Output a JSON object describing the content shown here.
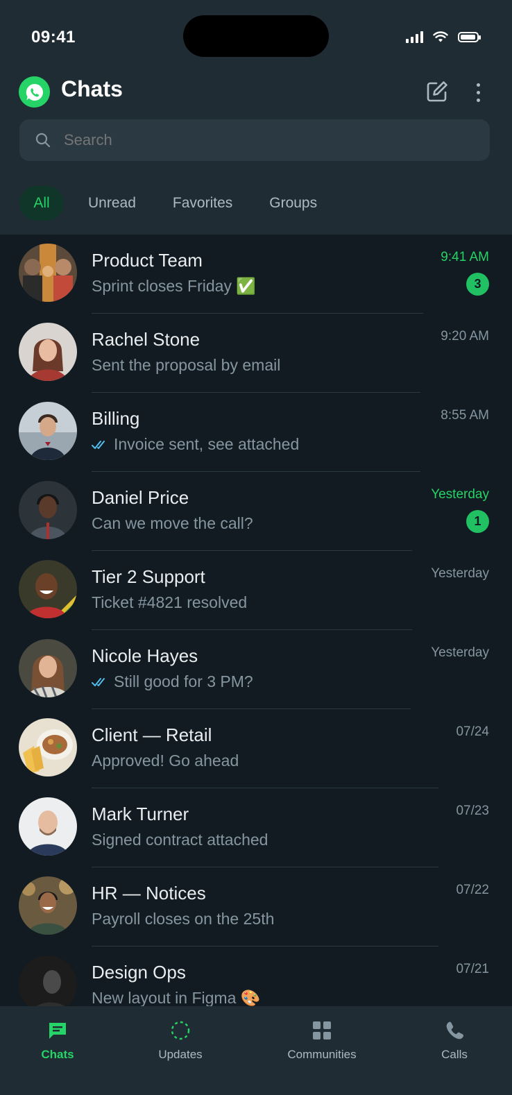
{
  "status_bar": {
    "time": "09:41"
  },
  "header": {
    "title": "Chats"
  },
  "search": {
    "placeholder": "Search"
  },
  "filters": [
    {
      "label": "All",
      "active": true
    },
    {
      "label": "Unread",
      "active": false
    },
    {
      "label": "Favorites",
      "active": false
    },
    {
      "label": "Groups",
      "active": false
    }
  ],
  "chats": [
    {
      "name": "Product Team",
      "preview": "Sprint closes Friday ✅",
      "time": "9:41 AM",
      "unread": "3",
      "read_ticks": false
    },
    {
      "name": "Rachel Stone",
      "preview": "Sent the proposal by email",
      "time": "9:20 AM",
      "unread": null,
      "read_ticks": false
    },
    {
      "name": "Billing",
      "preview": "Invoice sent, see attached",
      "time": "8:55 AM",
      "unread": null,
      "read_ticks": true
    },
    {
      "name": "Daniel Price",
      "preview": "Can we move the call?",
      "time": "Yesterday",
      "unread": "1",
      "read_ticks": false
    },
    {
      "name": "Tier 2 Support",
      "preview": "Ticket #4821 resolved",
      "time": "Yesterday",
      "unread": null,
      "read_ticks": false
    },
    {
      "name": "Nicole Hayes",
      "preview": "Still good for 3 PM?",
      "time": "Yesterday",
      "unread": null,
      "read_ticks": true
    },
    {
      "name": "Client — Retail",
      "preview": "Approved! Go ahead",
      "time": "07/24",
      "unread": null,
      "read_ticks": false
    },
    {
      "name": "Mark Turner",
      "preview": "Signed contract attached",
      "time": "07/23",
      "unread": null,
      "read_ticks": false
    },
    {
      "name": "HR — Notices",
      "preview": "Payroll closes on the 25th",
      "time": "07/22",
      "unread": null,
      "read_ticks": false
    },
    {
      "name": "Design Ops",
      "preview": "New layout in Figma 🎨",
      "time": "07/21",
      "unread": null,
      "read_ticks": false
    }
  ],
  "tabbar": [
    {
      "label": "Chats",
      "icon": "chat-bubble-icon",
      "active": true
    },
    {
      "label": "Updates",
      "icon": "status-ring-icon",
      "active": false
    },
    {
      "label": "Communities",
      "icon": "communities-grid-icon",
      "active": false
    },
    {
      "label": "Calls",
      "icon": "phone-icon",
      "active": false
    }
  ],
  "colors": {
    "background": "#111B21",
    "header": "#202C33",
    "accent": "#25D366",
    "read_tick": "#53BDEB",
    "secondary_text": "#8696A0"
  }
}
